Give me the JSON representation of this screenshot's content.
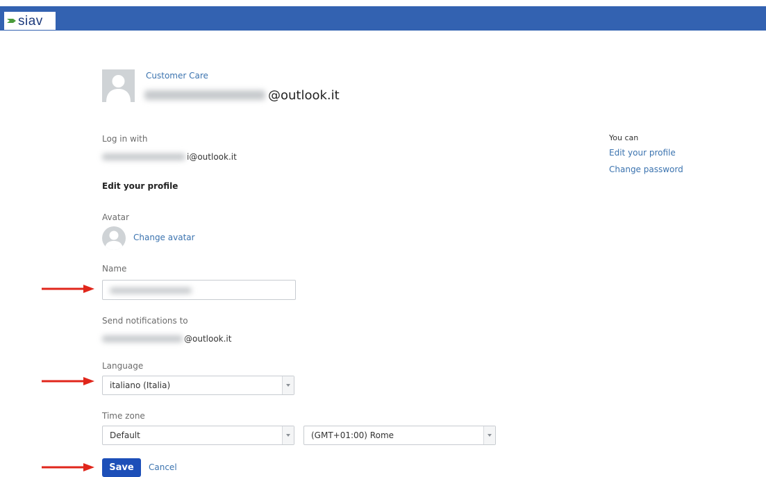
{
  "brand": {
    "logo_text": "siav",
    "bar_color": "#3362b1"
  },
  "header": {
    "org": "Customer Care",
    "email_suffix": "@outlook.it"
  },
  "login": {
    "label": "Log in with",
    "email_suffix": "i@outlook.it"
  },
  "section_title": "Edit your profile",
  "avatar": {
    "label": "Avatar",
    "change_link": "Change avatar"
  },
  "name": {
    "label": "Name",
    "value": ""
  },
  "notifications": {
    "label": "Send notifications to",
    "email_suffix": "@outlook.it"
  },
  "language": {
    "label": "Language",
    "selected": "italiano (Italia)"
  },
  "timezone": {
    "label": "Time zone",
    "region_selected": "Default",
    "zone_selected": "(GMT+01:00) Rome"
  },
  "actions": {
    "save": "Save",
    "cancel": "Cancel"
  },
  "sidebar": {
    "heading": "You can",
    "links": [
      "Edit your profile",
      "Change password"
    ]
  },
  "annotation": {
    "arrow_color": "#e0261b"
  }
}
